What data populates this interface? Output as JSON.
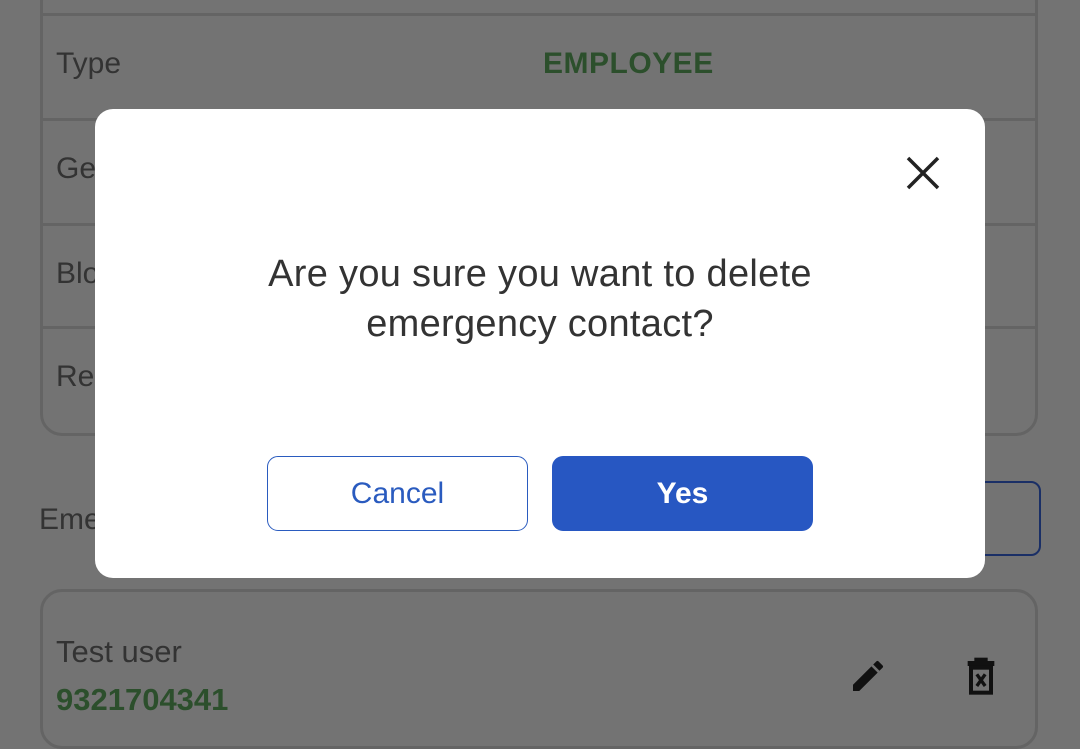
{
  "details_card": {
    "rows": [
      {
        "label": "Type",
        "value": "EMPLOYEE"
      },
      {
        "label": "Ge"
      },
      {
        "label": "Blo"
      },
      {
        "label": "Re"
      }
    ]
  },
  "emergency_section": {
    "heading": "Eme"
  },
  "contact": {
    "name": "Test user",
    "phone": "9321704341",
    "edit_icon": "pencil-icon",
    "delete_icon": "trash-x-icon"
  },
  "dialog": {
    "message_line1": "Are you sure you want to delete",
    "message_line2": "emergency contact?",
    "cancel_label": "Cancel",
    "yes_label": "Yes",
    "close_icon": "close-icon"
  },
  "colors": {
    "primary": "#2757c2",
    "value_green": "#4a9a3a",
    "overlay": "rgba(0,0,0,0.55)"
  }
}
